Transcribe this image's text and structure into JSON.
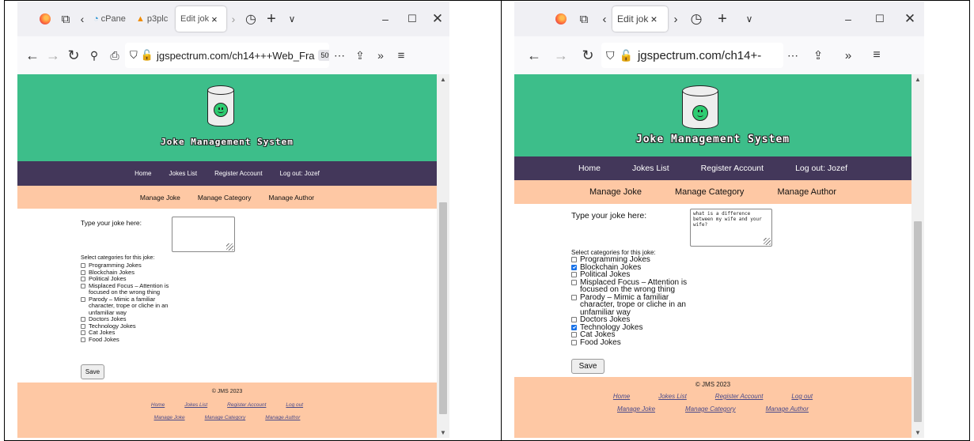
{
  "left": {
    "tabs": [
      {
        "label": "cPane",
        "icon": "cpanel-icon"
      },
      {
        "label": "p3plc",
        "icon": "cpanel-orange-icon"
      },
      {
        "label": "Edit jok",
        "active": true
      }
    ],
    "tab_close": "×",
    "url": "jgspectrum.com/ch14+++Web_Fra",
    "zoom": "50%"
  },
  "right": {
    "tabs": [
      {
        "label": "Edit jok",
        "active": true
      }
    ],
    "tab_close": "×",
    "url": "jgspectrum.com/ch14+-"
  },
  "site": {
    "title": "Joke Management System",
    "nav": [
      "Home",
      "Jokes List",
      "Register Account"
    ],
    "logout_left": "Log out: Jozef",
    "logout_right": "Log out: Jozef",
    "subnav": [
      "Manage Joke",
      "Manage Category",
      "Manage Author"
    ],
    "joke_label": "Type your joke here:",
    "joke_text_right": "what is a difference between my wife and your wife?",
    "categories_label": "Select categories for this joke:",
    "categories": [
      "Programming Jokes",
      "Blockchain Jokes",
      "Political Jokes",
      "Misplaced Focus – Attention is focused on the wrong thing",
      "Parody – Mimic a familiar character, trope or cliche in an unfamiliar way",
      "Doctors Jokes",
      "Technology Jokes",
      "Cat Jokes",
      "Food Jokes"
    ],
    "checked_right": [
      false,
      true,
      false,
      false,
      false,
      false,
      true,
      false,
      false
    ],
    "save_label": "Save",
    "copyright": "© JMS 2023",
    "footer_row1": [
      "Home",
      "Jokes List",
      "Register Account",
      "Log out"
    ],
    "footer_row2": [
      "Manage Joke",
      "Manage Category",
      "Manage Author"
    ]
  },
  "colors": {
    "header_green": "#3dbe8a",
    "nav_purple": "#43375a",
    "subnav_peach": "#fec8a4"
  }
}
